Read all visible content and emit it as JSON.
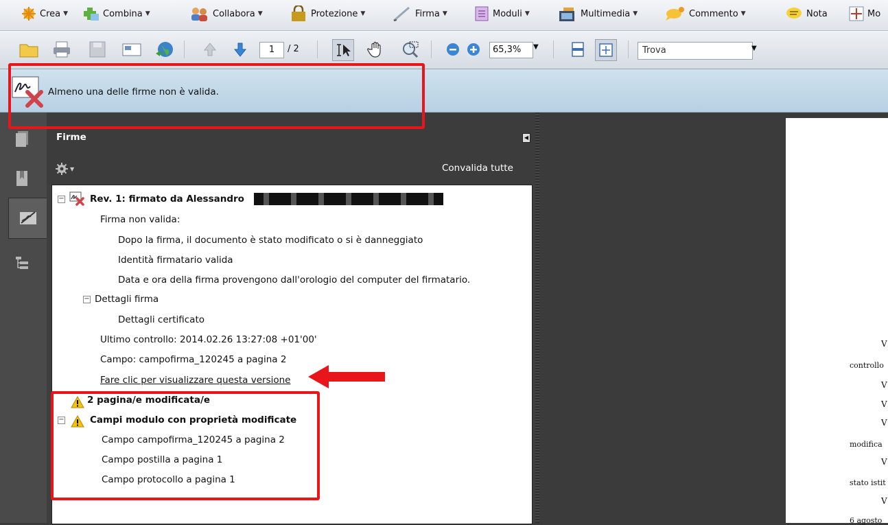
{
  "toolbar1": {
    "items": [
      {
        "label": "Crea",
        "icon": "create-icon"
      },
      {
        "label": "Combina",
        "icon": "combine-icon"
      },
      {
        "label": "Collabora",
        "icon": "collaborate-icon"
      },
      {
        "label": "Protezione",
        "icon": "lock-icon"
      },
      {
        "label": "Firma",
        "icon": "pen-icon"
      },
      {
        "label": "Moduli",
        "icon": "form-icon"
      },
      {
        "label": "Multimedia",
        "icon": "film-icon"
      },
      {
        "label": "Commento",
        "icon": "comment-icon"
      },
      {
        "label": "Nota",
        "icon": "note-icon"
      },
      {
        "label": "Mo",
        "icon": "measure-icon"
      }
    ]
  },
  "toolbar2": {
    "page_current": "1",
    "page_total": "/ 2",
    "zoom": "65,3%",
    "find_placeholder": "Trova"
  },
  "message_bar": {
    "text": "Almeno una delle firme non è valida."
  },
  "panel": {
    "title": "Firme",
    "validate_all": "Convalida tutte",
    "tree": {
      "rev_title": "Rev. 1: firmato da Alessandro",
      "invalid_label": "Firma non valida:",
      "invalid_details": [
        "Dopo la firma, il documento è stato modificato o si è danneggiato",
        "Identità firmatario valida",
        "Data e ora della firma provengono dall'orologio del computer del firmatario."
      ],
      "details_label": "Dettagli firma",
      "cert_details": "Dettagli certificato",
      "last_check": "Ultimo controllo: 2014.02.26 13:27:08 +01'00'",
      "field": "Campo: campofirma_120245 a pagina 2",
      "view_version_link": "Fare clic per visualizzare questa versione",
      "pages_modified": "2 pagina/e modificata/e",
      "form_fields_changed": "Campi modulo con proprietà modificate",
      "changed_fields": [
        "Campo campofirma_120245 a pagina 2",
        "Campo postilla a pagina 1",
        "Campo protocollo a pagina 1"
      ]
    }
  },
  "document": {
    "lines": [
      "V",
      "controllo",
      "V",
      "V",
      "V",
      "modifica",
      "V",
      "stato istit",
      "V",
      "6 agosto"
    ]
  },
  "colors": {
    "annotation_red": "#e8161a",
    "message_bar_blue": "#c3d9ea",
    "warning_yellow": "#f4c20d"
  }
}
